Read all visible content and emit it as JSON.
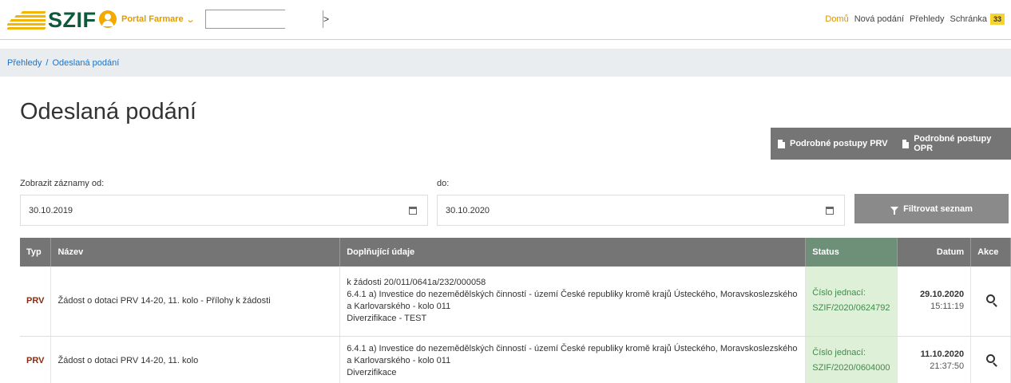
{
  "header": {
    "logo_text": "SZIF",
    "portal_label": "Portal Farmare",
    "search_placeholder": "",
    "nav": [
      {
        "label": "Domů",
        "active": true
      },
      {
        "label": "Nová podání",
        "active": false
      },
      {
        "label": "Přehledy",
        "active": false
      },
      {
        "label": "Schránka",
        "active": false
      }
    ],
    "inbox_count": "33"
  },
  "breadcrumb": {
    "items": [
      "Přehledy",
      "Odeslaná podání"
    ]
  },
  "page": {
    "title": "Odeslaná podání",
    "btn_prv": "Podrobné postupy PRV",
    "btn_opr": "Podrobné postupy OPR"
  },
  "filter": {
    "from_label": "Zobrazit záznamy od:",
    "from_value": "30.10.2019",
    "to_label": "do:",
    "to_value": "30.10.2020",
    "filter_button": "Filtrovat seznam"
  },
  "table": {
    "headers": {
      "typ": "Typ",
      "nazev": "Název",
      "doplnujici": "Doplňující údaje",
      "status": "Status",
      "datum": "Datum",
      "akce": "Akce"
    },
    "rows": [
      {
        "typ": "PRV",
        "nazev": "Žádost o dotaci PRV 14-20, 11. kolo - Přílohy k žádosti",
        "details": [
          "k žádosti 20/011/0641a/232/000058",
          "6.4.1 a) Investice do nezemědělských činností - území České republiky kromě krajů Ústeckého, Moravskoslezského a Karlovarského - kolo 011",
          "Diverzifikace - TEST"
        ],
        "status_label": "Číslo jednací:",
        "status_value": "SZIF/2020/0624792",
        "date": "29.10.2020",
        "time": "15:11:19"
      },
      {
        "typ": "PRV",
        "nazev": "Žádost o dotaci PRV 14-20, 11. kolo",
        "details": [
          "6.4.1 a) Investice do nezemědělských činností - území České republiky kromě krajů Ústeckého, Moravskoslezského a Karlovarského - kolo 011",
          "Diverzifikace"
        ],
        "status_label": "Číslo jednací:",
        "status_value": "SZIF/2020/0604000",
        "date": "11.10.2020",
        "time": "21:37:50"
      }
    ]
  },
  "colors": {
    "accent": "#e09b00",
    "logo_green": "#0d5a3b",
    "link": "#1a73c9",
    "status_bg": "#dff0d8",
    "typ_color": "#8b2b10"
  },
  "icons": {
    "portal": "user-circle-icon",
    "portal_chevron": "chevron-down-icon",
    "search_go": "chevron-right-icon",
    "doc": "document-icon",
    "calendar": "calendar-icon",
    "filter": "filter-icon",
    "detail": "search-icon"
  }
}
